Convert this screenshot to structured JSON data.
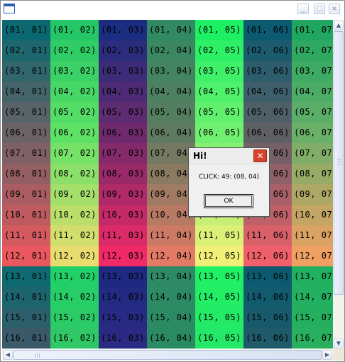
{
  "window": {
    "title": "",
    "icon": "window-app-icon",
    "controls": {
      "minimize": "minimize-icon",
      "maximize": "maximize-icon",
      "close": "close-icon"
    }
  },
  "grid": {
    "columns": [
      {
        "id": "01",
        "top_color": "#0d6470",
        "bottom_color": "#3a5a6a"
      },
      {
        "id": "02",
        "top_color": "#1fcf63",
        "bottom_color": "#30d060"
      },
      {
        "id": "03",
        "top_color": "#1a277a",
        "bottom_color": "#2a2a80"
      },
      {
        "id": "04",
        "top_color": "#2a8a66",
        "bottom_color": "#2a8a60"
      },
      {
        "id": "05",
        "top_color": "#12f061",
        "bottom_color": "#20e868"
      },
      {
        "id": "06",
        "top_color": "#05596f",
        "bottom_color": "#1e5a6a"
      },
      {
        "id": "07",
        "top_color": "#1aa760",
        "bottom_color": "#20b060"
      }
    ],
    "rows": [
      "01",
      "02",
      "03",
      "04",
      "05",
      "06",
      "07",
      "08",
      "09",
      "10",
      "11",
      "12",
      "13",
      "14",
      "15",
      "16"
    ],
    "row_colors": {
      "01": [
        "#0b6870",
        "#25c666",
        "#1a2d80",
        "#328a62",
        "#1ef064",
        "#0c5a70",
        "#20a661"
      ],
      "06": [
        "#6a6266",
        "#5ee266",
        "#6e2a6c",
        "#5e7a60",
        "#70f070",
        "#5e6066",
        "#6ab068"
      ],
      "12": [
        "#e8585e",
        "#e8dc6e",
        "#f02a66",
        "#e27a66",
        "#f0f078",
        "#f0606a",
        "#f0a062"
      ],
      "13": [
        "#0e6a70",
        "#22d068",
        "#1e2a82",
        "#2e8a66",
        "#20f064",
        "#0c5a70",
        "#20b060"
      ],
      "16": [
        "#3a5a6a",
        "#30c866",
        "#2a2a82",
        "#2a8a62",
        "#24e868",
        "#1e5a6a",
        "#28b060"
      ]
    }
  },
  "dialog": {
    "title": "Hi!",
    "message": "CLICK: 49: (08, 04)",
    "ok_label": "OK",
    "close_icon": "close-icon"
  },
  "scrollbars": {
    "vertical": {
      "up_icon": "arrow-up-icon",
      "down_icon": "arrow-down-icon"
    },
    "horizontal": {
      "left_icon": "arrow-left-icon",
      "right_icon": "arrow-right-icon"
    }
  }
}
